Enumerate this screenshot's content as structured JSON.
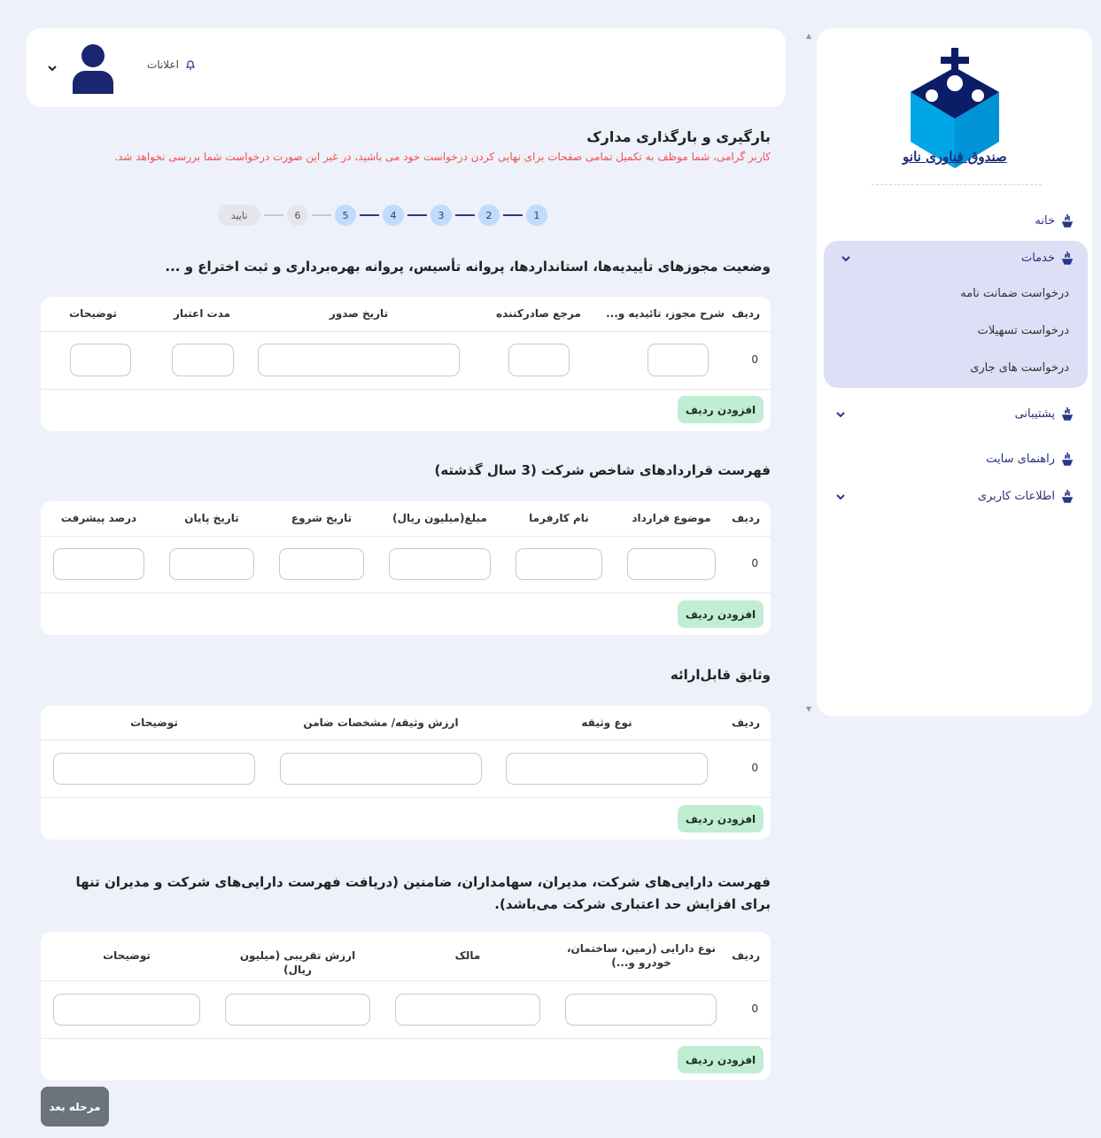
{
  "sidebar": {
    "logo_text": "صندوق فناوری نانو",
    "nav": {
      "home": "خانه",
      "services": "خدمات",
      "support": "پشتیبانی",
      "guide": "راهنمای سایت",
      "user_info": "اطلاعات کاربری"
    },
    "services_sub": [
      "درخواست ضمانت نامه",
      "درخواست تسهیلات",
      "درخواست های جاری"
    ]
  },
  "header": {
    "notifications": "اعلانات"
  },
  "page": {
    "title": "بارگیری و بارگذاری مدارک",
    "warning": "کاربر گرامی، شما موظف به تکمیل تمامی صفحات برای نهایی کردن درخواست خود می باشید، در غیر این صورت درخواست شما بررسی نخواهد شد."
  },
  "steps": [
    "1",
    "2",
    "3",
    "4",
    "5",
    "6",
    "تایید"
  ],
  "active_steps": 5,
  "sections": {
    "permits": {
      "title": "وضعیت مجوزهای تأییدیه‌ها، استانداردها، پروانه تأسیس، پروانه بهره‌برداری و ثبت اختراع و ...",
      "headers": [
        "ردیف",
        "شرح مجوز، تائیدیه و...",
        "مرجع صادرکننده",
        "تاریخ صدور",
        "مدت اعتبار",
        "توضیحات"
      ],
      "row_index": "0",
      "add_label": "افزودن ردیف"
    },
    "contracts": {
      "title": "فهرست قراردادهای شاخص شرکت (3 سال گذشته)",
      "headers": [
        "ردیف",
        "موضوع قرارداد",
        "نام کارفرما",
        "مبلغ(میلیون ریال)",
        "تاریخ شروع",
        "تاریخ پایان",
        "درصد پیشرفت"
      ],
      "row_index": "0",
      "add_label": "افزودن ردیف"
    },
    "collateral": {
      "title": "وثایق قابل‌ارائه",
      "headers": [
        "ردیف",
        "نوع وثیقه",
        "ارزش وثیقه/ مشخصات ضامن",
        "توضیحات"
      ],
      "row_index": "0",
      "add_label": "افزودن ردیف"
    },
    "assets": {
      "title": "فهرست دارایی‌های شرکت، مدیران، سهامداران، ضامنین (دریافت فهرست دارایی‌های شرکت و مدیران تنها برای افزایش حد اعتباری شرکت می‌باشد).",
      "headers": [
        "ردیف",
        "نوع دارایی (زمین، ساختمان، خودرو و...)",
        "مالک",
        "ارزش تقریبی (میلیون ریال)",
        "توضیحات"
      ],
      "row_index": "0",
      "add_label": "افزودن ردیف"
    }
  },
  "next_button": "مرحله بعد",
  "colors": {
    "primary": "#2b3788",
    "step_active": "#bfdcf8",
    "add_button": "#bfeed3",
    "warning": "#ef5350",
    "sidebar_active": "#dcdff5"
  }
}
